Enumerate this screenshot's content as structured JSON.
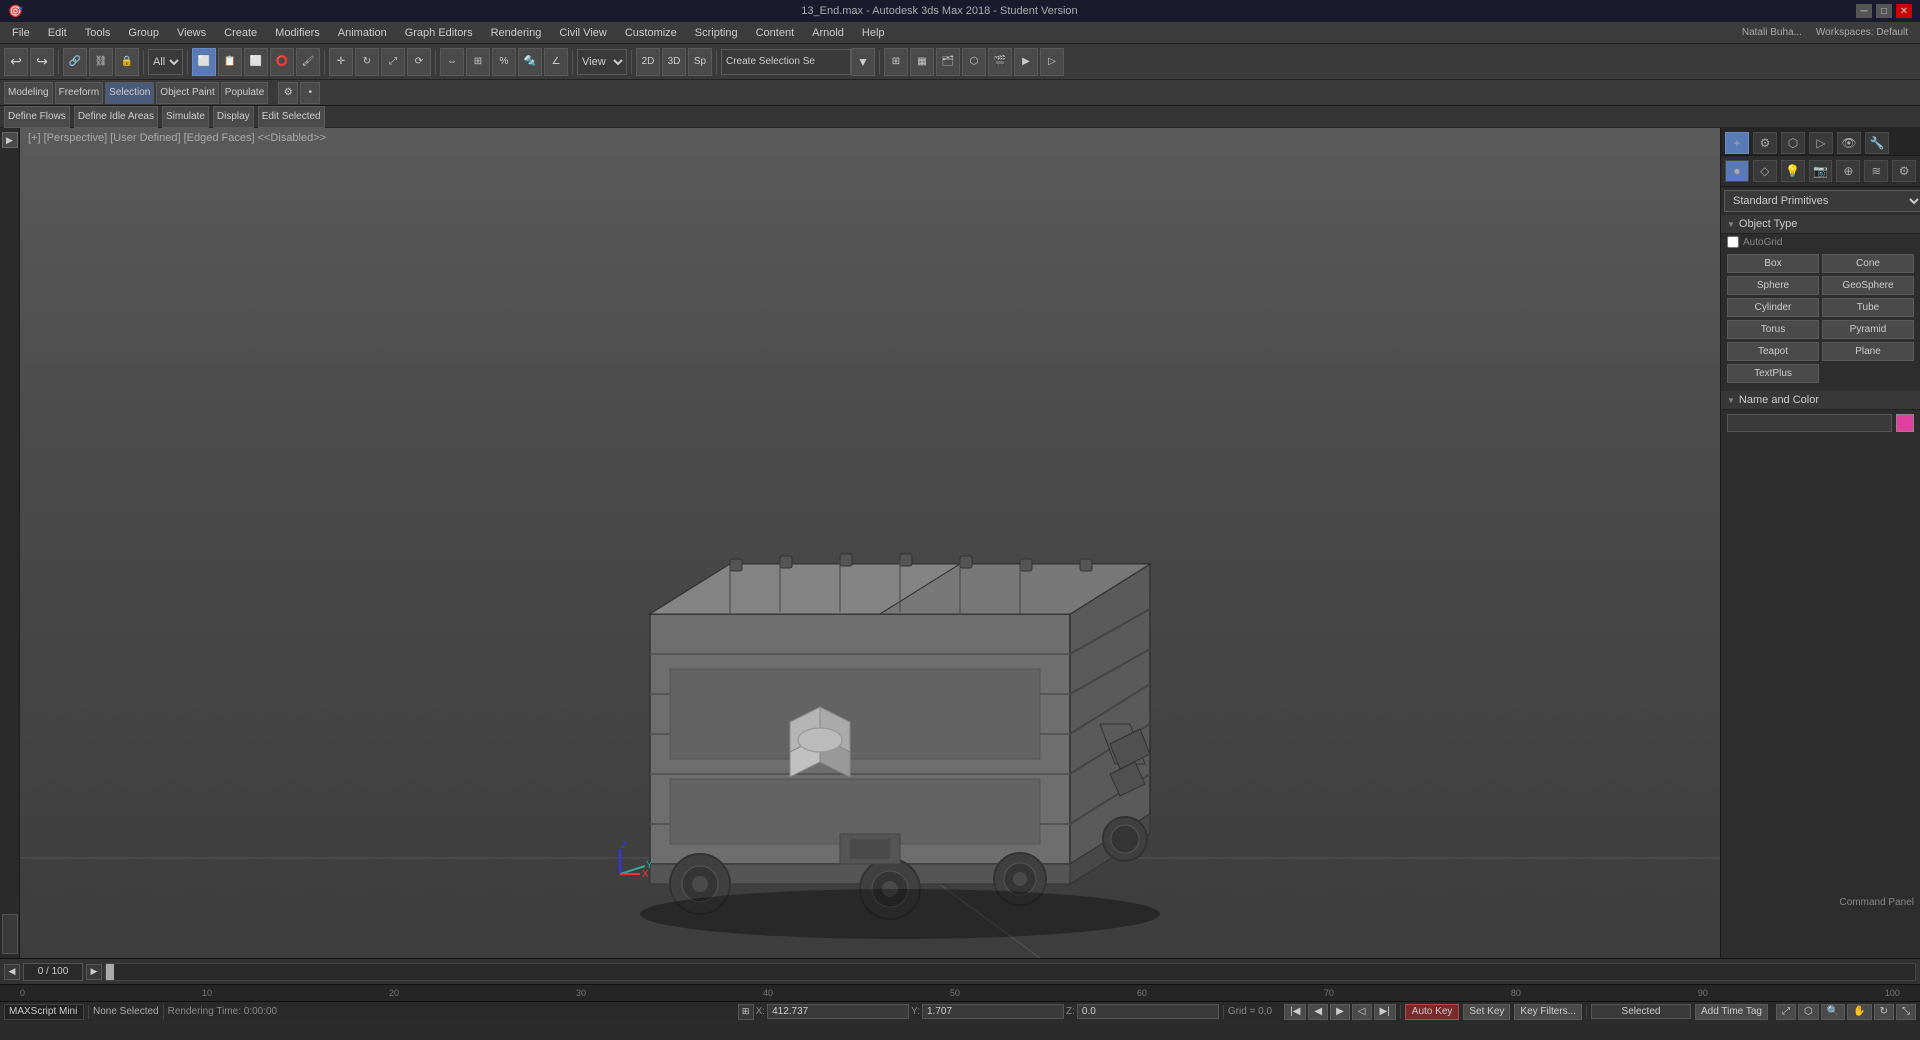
{
  "titlebar": {
    "title": "13_End.max - Autodesk 3ds Max 2018 - Student Version",
    "controls": [
      "minimize",
      "maximize",
      "close"
    ]
  },
  "menubar": {
    "items": [
      "File",
      "Edit",
      "Tools",
      "Group",
      "Views",
      "Create",
      "Modifiers",
      "Animation",
      "Graph Editors",
      "Rendering",
      "Civil View",
      "Customize",
      "Scripting",
      "Content",
      "Arnold",
      "Help"
    ]
  },
  "toolbar": {
    "undo_label": "↩",
    "redo_label": "↪",
    "select_filter": "All",
    "viewport_label": "View",
    "create_selection_label": "Create Selection Se",
    "workspace_label": "Workspaces: Default",
    "user_label": "Natali Buha..."
  },
  "mode_tabs": {
    "items": [
      "Modeling",
      "Freeform",
      "Selection",
      "Object Paint",
      "Populate"
    ]
  },
  "edit_toolbar": {
    "items": [
      "Define Flows",
      "Define Idle Areas",
      "Simulate",
      "Display",
      "Edit Selected"
    ]
  },
  "viewport": {
    "label": "[+] [Perspective] [User Defined] [Edged Faces] <<Disabled>>",
    "bg_color": "#4a4a4a"
  },
  "right_panel": {
    "dropdown": "Standard Primitives",
    "object_type_label": "Object Type",
    "autogrid_label": "AutoGrid",
    "objects": [
      {
        "name": "Box",
        "col": 0
      },
      {
        "name": "Cone",
        "col": 1
      },
      {
        "name": "Sphere",
        "col": 0
      },
      {
        "name": "GeoSphere",
        "col": 1
      },
      {
        "name": "Cylinder",
        "col": 0
      },
      {
        "name": "Tube",
        "col": 1
      },
      {
        "name": "Torus",
        "col": 0
      },
      {
        "name": "Pyramid",
        "col": 1
      },
      {
        "name": "Teapot",
        "col": 0
      },
      {
        "name": "Plane",
        "col": 1
      },
      {
        "name": "TextPlus",
        "col": 0
      }
    ],
    "name_color_label": "Name and Color",
    "color_swatch": "#e040a0",
    "command_panel_label": "Command Panel"
  },
  "timeline": {
    "frame_current": "0",
    "frame_total": "100",
    "time_marks": [
      "0",
      "10",
      "20",
      "30",
      "40",
      "50",
      "60",
      "70",
      "80",
      "90",
      "100"
    ]
  },
  "status_bar": {
    "script_label": "MAXScript Mini",
    "render_time": "Rendering Time: 0:00:00",
    "none_selected": "None Selected",
    "x_label": "X:",
    "x_value": "412.737",
    "y_label": "Y:",
    "y_value": "1.707",
    "z_label": "Z:",
    "z_value": "0.0",
    "grid_label": "Grid = 0,0",
    "auto_key_label": "Auto Key",
    "set_key_label": "Set Key",
    "key_filters_label": "Key Filters...",
    "selected_label": "Selected",
    "add_time_tag": "Add Time Tag"
  }
}
